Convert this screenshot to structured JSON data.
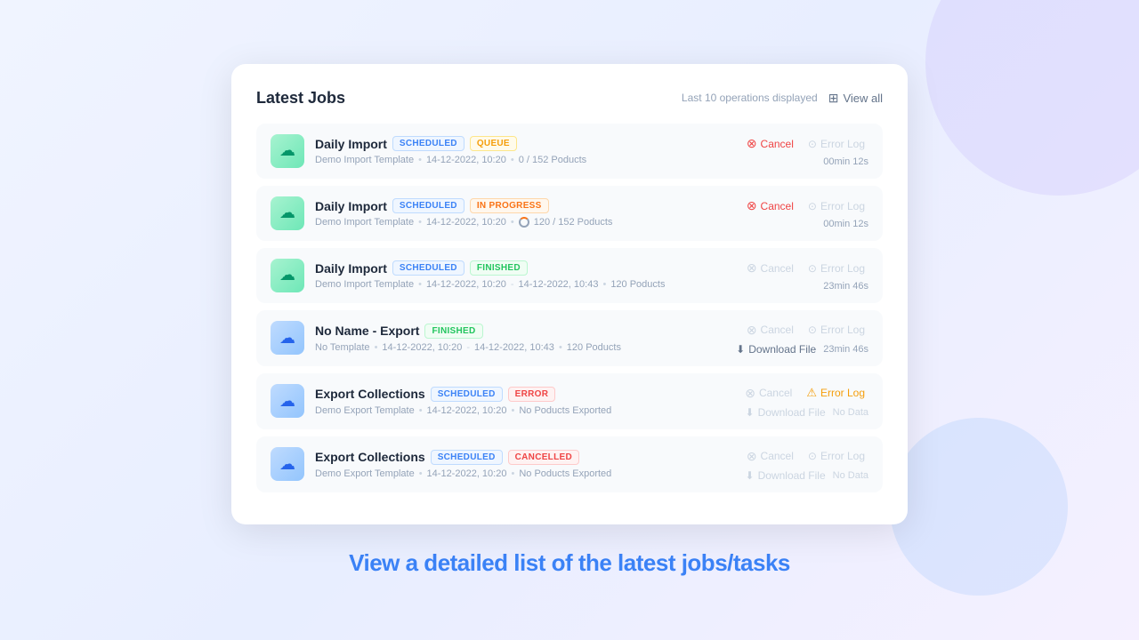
{
  "header": {
    "title": "Latest Jobs",
    "last_ops_label": "Last 10 operations displayed",
    "view_all_label": "View all"
  },
  "jobs": [
    {
      "id": 1,
      "name": "Daily Import",
      "icon_type": "import",
      "badges": [
        {
          "type": "scheduled",
          "label": "SCHEDULED",
          "prefix": "🗓"
        },
        {
          "type": "queue",
          "label": "QUEUE",
          "prefix": "⊙"
        }
      ],
      "template": "Demo Import Template",
      "date": "14-12-2022, 10:20",
      "date_end": null,
      "progress": "0 / 152 Poducts",
      "has_progress_icon": false,
      "cancel_active": true,
      "cancel_label": "Cancel",
      "errorlog_type": "disabled",
      "errorlog_label": "Error Log",
      "time": "00min 12s",
      "download_label": null,
      "download_active": false,
      "no_data": false
    },
    {
      "id": 2,
      "name": "Daily Import",
      "icon_type": "import",
      "badges": [
        {
          "type": "scheduled",
          "label": "SCHEDULED",
          "prefix": "🗓"
        },
        {
          "type": "in-progress",
          "label": "IN PROGRESS",
          "prefix": "⊙"
        }
      ],
      "template": "Demo Import Template",
      "date": "14-12-2022, 10:20",
      "date_end": null,
      "progress": "120 / 152 Poducts",
      "has_progress_icon": true,
      "cancel_active": true,
      "cancel_label": "Cancel",
      "errorlog_type": "disabled",
      "errorlog_label": "Error Log",
      "time": "00min 12s",
      "download_label": null,
      "download_active": false,
      "no_data": false
    },
    {
      "id": 3,
      "name": "Daily Import",
      "icon_type": "import",
      "badges": [
        {
          "type": "scheduled",
          "label": "SCHEDULED",
          "prefix": "🗓"
        },
        {
          "type": "finished",
          "label": "FINISHED",
          "prefix": "✓"
        }
      ],
      "template": "Demo Import Template",
      "date": "14-12-2022, 10:20",
      "date_end": "14-12-2022, 10:43",
      "progress": "120 Poducts",
      "has_progress_icon": false,
      "cancel_active": false,
      "cancel_label": "Cancel",
      "errorlog_type": "disabled",
      "errorlog_label": "Error Log",
      "time": "23min 46s",
      "download_label": null,
      "download_active": false,
      "no_data": false
    },
    {
      "id": 4,
      "name": "No Name - Export",
      "icon_type": "export",
      "badges": [
        {
          "type": "finished",
          "label": "FINISHED",
          "prefix": "✓"
        }
      ],
      "template": "No Template",
      "date": "14-12-2022, 10:20",
      "date_end": "14-12-2022, 10:43",
      "progress": "120 Poducts",
      "has_progress_icon": false,
      "cancel_active": false,
      "cancel_label": "Cancel",
      "errorlog_type": "disabled",
      "errorlog_label": "Error Log",
      "time": "23min 46s",
      "download_label": "Download File",
      "download_active": true,
      "no_data": false
    },
    {
      "id": 5,
      "name": "Export Collections",
      "icon_type": "export",
      "badges": [
        {
          "type": "scheduled",
          "label": "SCHEDULED",
          "prefix": "🗓"
        },
        {
          "type": "error",
          "label": "ERROR",
          "prefix": "⊗"
        }
      ],
      "template": "Demo Export Template",
      "date": "14-12-2022, 10:20",
      "date_end": null,
      "progress": "No Poducts Exported",
      "has_progress_icon": false,
      "cancel_active": false,
      "cancel_label": "Cancel",
      "errorlog_type": "error",
      "errorlog_label": "Error Log",
      "time": null,
      "download_label": "Download File",
      "download_active": false,
      "no_data": true
    },
    {
      "id": 6,
      "name": "Export Collections",
      "icon_type": "export",
      "badges": [
        {
          "type": "scheduled",
          "label": "SCHEDULED",
          "prefix": "🗓"
        },
        {
          "type": "cancelled",
          "label": "CANCELLED",
          "prefix": "⊗"
        }
      ],
      "template": "Demo Export Template",
      "date": "14-12-2022, 10:20",
      "date_end": null,
      "progress": "No Poducts Exported",
      "has_progress_icon": false,
      "cancel_active": false,
      "cancel_label": "Cancel",
      "errorlog_type": "disabled",
      "errorlog_label": "Error Log",
      "time": null,
      "download_label": "Download File",
      "download_active": false,
      "no_data": true
    }
  ],
  "tagline": "View a detailed list of the latest jobs/tasks"
}
